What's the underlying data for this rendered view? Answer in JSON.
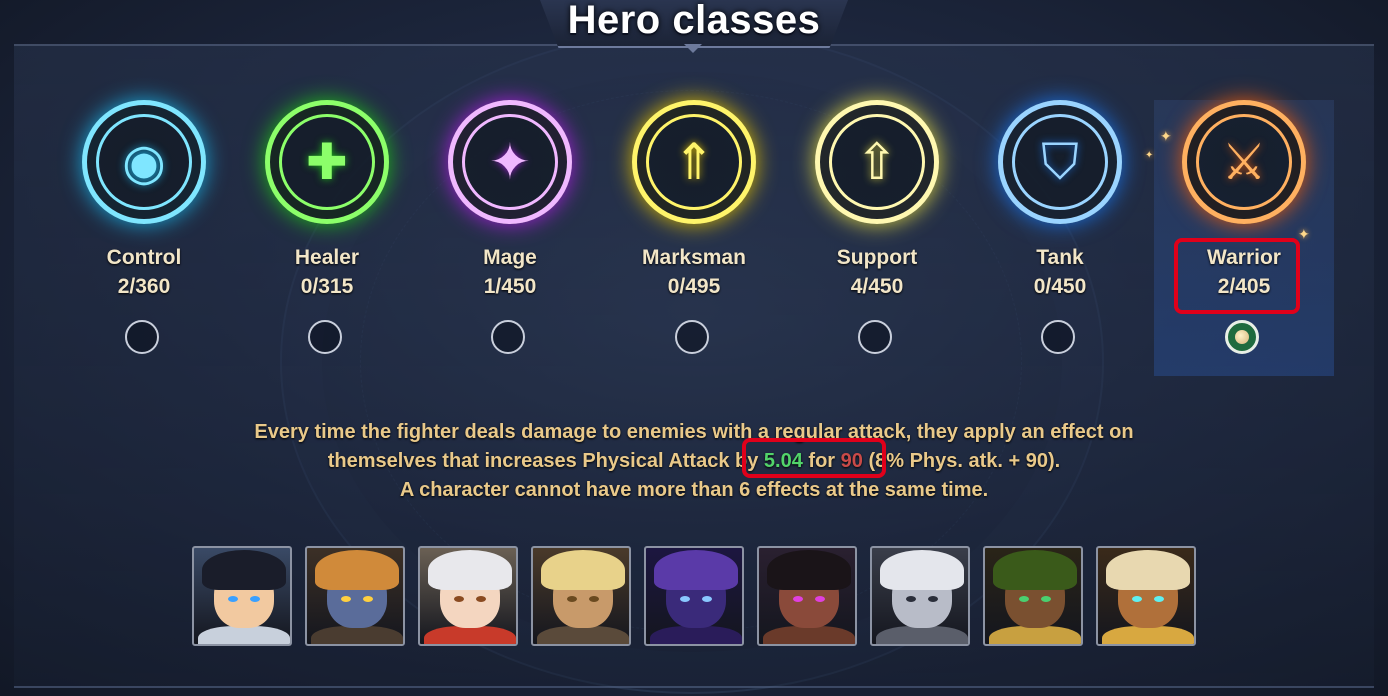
{
  "header": {
    "title": "Hero classes"
  },
  "classes": [
    {
      "name": "Control",
      "count": "2/360",
      "color": "#7fe6ff",
      "glow": "#1aa6d8",
      "icon": "eye-icon",
      "glyph": "◉",
      "selected": false
    },
    {
      "name": "Healer",
      "count": "0/315",
      "color": "#8cff6a",
      "glow": "#1fb81a",
      "icon": "cross-icon",
      "glyph": "✚",
      "selected": false
    },
    {
      "name": "Mage",
      "count": "1/450",
      "color": "#f0b8ff",
      "glow": "#a420d8",
      "icon": "book-icon",
      "glyph": "✦",
      "selected": false
    },
    {
      "name": "Marksman",
      "count": "0/495",
      "color": "#fff46a",
      "glow": "#d8b800",
      "icon": "bow-icon",
      "glyph": "⇑",
      "selected": false
    },
    {
      "name": "Support",
      "count": "4/450",
      "color": "#fff8b0",
      "glow": "#d8d040",
      "icon": "arrow-icon",
      "glyph": "⇧",
      "selected": false
    },
    {
      "name": "Tank",
      "count": "0/450",
      "color": "#9ad4ff",
      "glow": "#1a70e0",
      "icon": "shield-icon",
      "glyph": "⛉",
      "selected": false
    },
    {
      "name": "Warrior",
      "count": "2/405",
      "color": "#ffb060",
      "glow": "#e05a10",
      "icon": "crossed-swords-icon",
      "glyph": "⚔",
      "selected": true
    }
  ],
  "description": {
    "line1": "Every time the fighter deals damage to enemies with a regular attack, they apply an effect on",
    "line2_prefix": "themselves that increases Physical Attack by ",
    "value_green": "5.04",
    "mid": " for ",
    "value_red": "90",
    "line2_suffix": " (8% Phys. atk. + 90).",
    "line3": "A character cannot have more than 6 effects at the same time."
  },
  "heroes": [
    {
      "name": "hero-portrait-1",
      "skin": "#f2c9a0",
      "hair": "#1a1d2a",
      "eye": "#3aa0ff",
      "body": "#c8d0dc",
      "bg": "#3a4a66"
    },
    {
      "name": "hero-portrait-2",
      "skin": "#5a6c9a",
      "hair": "#d08a3a",
      "eye": "#ffd040",
      "body": "#4a3c30",
      "bg": "#3c3026"
    },
    {
      "name": "hero-portrait-3",
      "skin": "#f4d6c0",
      "hair": "#e8e8ec",
      "eye": "#8a4a20",
      "body": "#c83a2a",
      "bg": "#6a6054"
    },
    {
      "name": "hero-portrait-4",
      "skin": "#c89a6a",
      "hair": "#e8d28a",
      "eye": "#6a4a20",
      "body": "#5a4a3a",
      "bg": "#4a3a2a"
    },
    {
      "name": "hero-portrait-5",
      "skin": "#3a2a7a",
      "hair": "#5a3aa8",
      "eye": "#8ac8ff",
      "body": "#2a1c5a",
      "bg": "#1c1640"
    },
    {
      "name": "hero-portrait-6",
      "skin": "#8a4a3a",
      "hair": "#1a1418",
      "eye": "#e040e0",
      "body": "#6a3a2a",
      "bg": "#2a2030"
    },
    {
      "name": "hero-portrait-7",
      "skin": "#b8bcc8",
      "hair": "#e4e6ec",
      "eye": "#2a2e3a",
      "body": "#5a5e6a",
      "bg": "#3a3e4a"
    },
    {
      "name": "hero-portrait-8",
      "skin": "#7a5030",
      "hair": "#3a5a1a",
      "eye": "#4ad070",
      "body": "#c8a040",
      "bg": "#2a2418"
    },
    {
      "name": "hero-portrait-9",
      "skin": "#b0703a",
      "hair": "#e8d8b0",
      "eye": "#60f0f0",
      "body": "#d8a840",
      "bg": "#3a2a1a"
    }
  ]
}
